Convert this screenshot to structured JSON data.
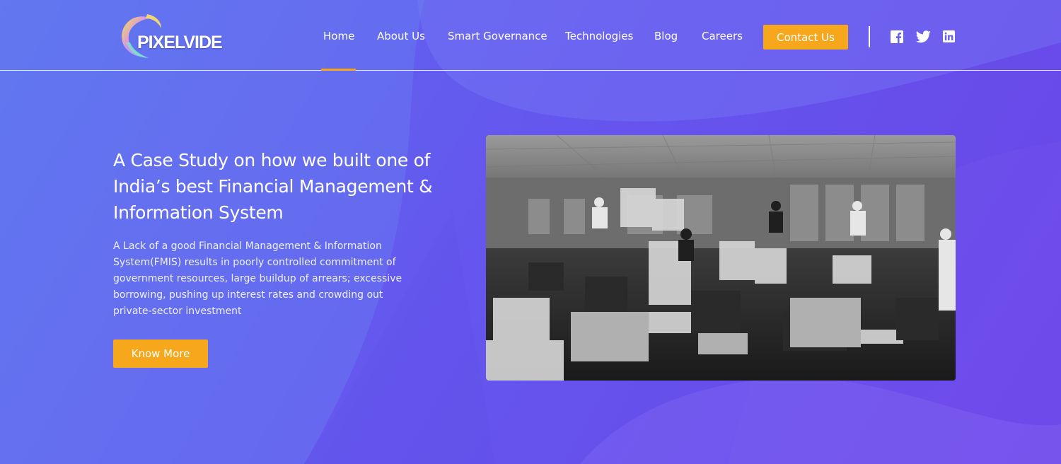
{
  "brand": {
    "logo_text": "PIXELVIDE"
  },
  "nav": {
    "items": [
      {
        "label": "Home",
        "active": true
      },
      {
        "label": "About Us"
      },
      {
        "label": "Smart Governance"
      },
      {
        "label": "Technologies"
      },
      {
        "label": "Blog"
      },
      {
        "label": "Careers"
      }
    ],
    "contact_label": "Contact Us"
  },
  "social": [
    {
      "icon": "facebook-icon"
    },
    {
      "icon": "twitter-icon"
    },
    {
      "icon": "linkedin-icon"
    }
  ],
  "hero": {
    "title": "A Case Study on how we built one of India’s best Financial Management & Information System",
    "description": "A Lack of a good Financial Management & Information System(FMIS) results in poorly controlled commitment of government resources, large buildup of arrears; excessive borrowing, pushing up interest rates and crowding out private-sector investment",
    "cta_label": "Know More"
  },
  "colors": {
    "accent": "#f6a71c",
    "background_start": "#5e6ff0",
    "background_end": "#6a45e8"
  }
}
